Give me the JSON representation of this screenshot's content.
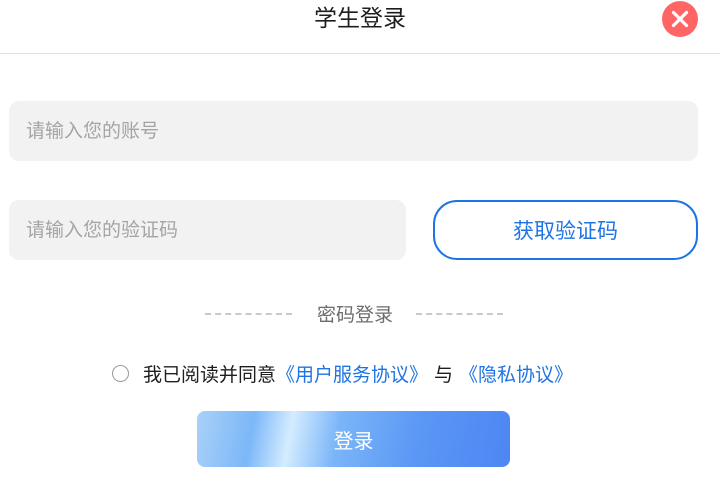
{
  "header": {
    "title": "学生登录"
  },
  "form": {
    "account_placeholder": "请输入您的账号",
    "code_placeholder": "请输入您的验证码",
    "get_code_label": "获取验证码"
  },
  "divider": {
    "label": "密码登录"
  },
  "agreement": {
    "prefix": "我已阅读并同意",
    "service_link": "《用户服务协议》",
    "conjunction": "与",
    "privacy_link": "《隐私协议》",
    "checked": false
  },
  "login": {
    "label": "登录"
  },
  "colors": {
    "accent": "#1e74e4",
    "close": "#ff6565",
    "input_bg": "#f2f2f2"
  },
  "icons": {
    "close": "close-icon"
  }
}
